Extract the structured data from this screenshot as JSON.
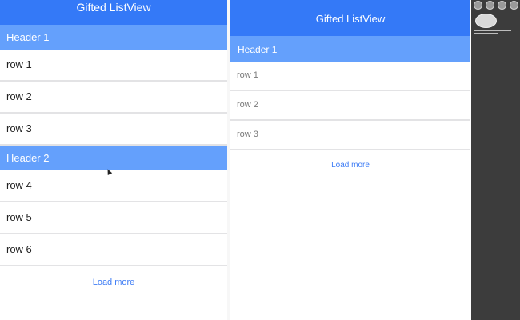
{
  "left_list": {
    "title": "Gifted ListView",
    "sections": [
      {
        "header": "Header 1",
        "rows": [
          "row 1",
          "row 2",
          "row 3"
        ]
      },
      {
        "header": "Header 2",
        "rows": [
          "row 4",
          "row 5",
          "row 6"
        ]
      }
    ],
    "load_more": "Load more"
  },
  "right_list": {
    "title": "Gifted ListView",
    "sections": [
      {
        "header": "Header 1",
        "rows": [
          "row 1",
          "row 2",
          "row 3"
        ]
      }
    ],
    "load_more": "Load more"
  },
  "colors": {
    "navbar": "#3479f7",
    "section_header": "#64a0fc",
    "link": "#3f7df5",
    "sidebar": "#3c3c3c"
  },
  "icons": {
    "window_buttons": [
      "close-icon",
      "minimize-icon",
      "zoom-icon",
      "fullscreen-icon"
    ],
    "cursor": "mouse-pointer-icon"
  }
}
